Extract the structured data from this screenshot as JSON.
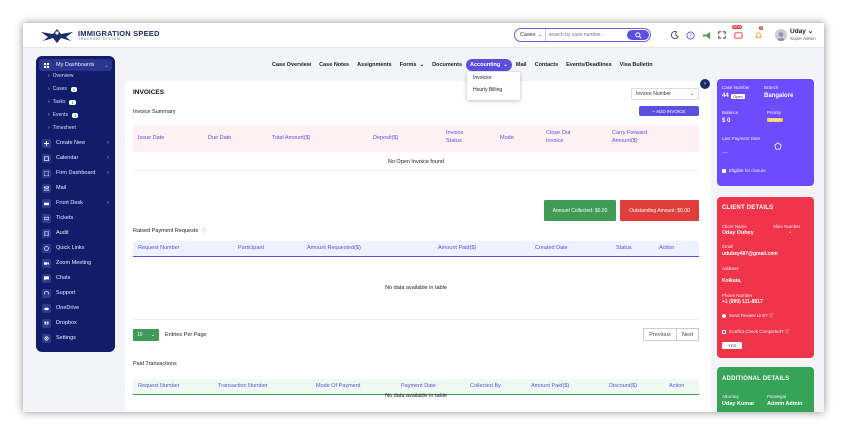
{
  "header": {
    "logo_title": "IMMIGRATION SPEED",
    "logo_sub": "TRACKING SYSTEM",
    "search_scope": "Cases",
    "search_placeholder": "search by case number...",
    "notif_badge_1": "NEW",
    "notif_badge_2": "0",
    "user_name": "Uday",
    "user_role": "Super Admin"
  },
  "sidebar": {
    "items": [
      {
        "label": "My Dashboards"
      },
      {
        "label": "Create New"
      },
      {
        "label": "Calendar"
      },
      {
        "label": "Firm Dashboard"
      },
      {
        "label": "Mail"
      },
      {
        "label": "Front Desk"
      },
      {
        "label": "Tickets"
      },
      {
        "label": "Audit"
      },
      {
        "label": "Quick Links"
      },
      {
        "label": "Zoom Meeting"
      },
      {
        "label": "Chats"
      },
      {
        "label": "Support"
      },
      {
        "label": "OneDrive"
      },
      {
        "label": "Dropbox"
      },
      {
        "label": "Settings"
      }
    ],
    "subitems": [
      {
        "label": "Overview",
        "count": ""
      },
      {
        "label": "Cases",
        "count": "1"
      },
      {
        "label": "Tasks",
        "count": "1"
      },
      {
        "label": "Events",
        "count": "1"
      },
      {
        "label": "Timesheet",
        "count": ""
      }
    ]
  },
  "tabs": [
    {
      "label": "Case Overview"
    },
    {
      "label": "Case Notes"
    },
    {
      "label": "Assignments"
    },
    {
      "label": "Forms"
    },
    {
      "label": "Documents"
    },
    {
      "label": "Accounting"
    },
    {
      "label": "Mail"
    },
    {
      "label": "Contacts"
    },
    {
      "label": "Events/Deadlines"
    },
    {
      "label": "Visa Bulletin"
    }
  ],
  "accounting_menu": {
    "invoices": "Invoices",
    "hourly": "Hourly Billing"
  },
  "invoices": {
    "title": "INVOICES",
    "select_value": "Invoice Number",
    "summary_title": "Invoice Summary",
    "add_button": "+ ADD INVOICE",
    "columns": [
      "Issue Date",
      "Due Date",
      "Total Amount($)",
      "Deposit($)",
      "Invoice Status",
      "Mode",
      "Close Out Invoice",
      "Carry Forward Amount($)"
    ],
    "empty": "No Open Invoice found",
    "collected": "Amount Collected: $0.00",
    "outstanding": "Outstanding Amount: $0.00"
  },
  "payment_requests": {
    "title": "Raised Payment Requests",
    "columns": [
      "Request Number",
      "Participant",
      "Amount Requested($)",
      "Amount Paid($)",
      "Created Date",
      "Status",
      "Action"
    ],
    "empty": "No data available in table",
    "entries_value": "10",
    "entries_label": "Entries Per Page",
    "prev": "Previous",
    "next": "Next"
  },
  "paid_transactions": {
    "title": "Paid Transactions",
    "columns": [
      "Request Number",
      "Transaction Number",
      "Mode Of Payment",
      "Payment Date",
      "Collected By",
      "Amount Paid($)",
      "Discount($)",
      "Action"
    ],
    "empty": "No data available in table"
  },
  "case_card": {
    "case_number_label": "Case Number",
    "case_number": "44",
    "open_badge": "Open",
    "branch_label": "Branch",
    "branch": "Bangalore",
    "balance_label": "Balance",
    "balance": "$ 0",
    "priority_label": "Priority",
    "priority": "Medium",
    "last_payment_label": "Last Payment Date",
    "last_payment": "----",
    "eligible_label": "Eligible for closure"
  },
  "client_card": {
    "title": "CLIENT DETAILS",
    "client_name_label": "Client Name",
    "client_name": "Uday Dubey",
    "alien_label": "Alien Number",
    "email_label": "Email",
    "email": "udubey487@gmail.com",
    "address_label": "Address",
    "address": "Kolkata,",
    "phone_label": "Phone Number",
    "phone": "+1 (999) 111-8917",
    "send_review": "Send Review Link?",
    "conflict": "Conflict Check Completed?",
    "yes": "YES"
  },
  "additional_card": {
    "title": "ADDITIONAL DETAILS",
    "attorney_label": "Attorney",
    "attorney": "Uday Kumar",
    "paralegal_label": "Paralegal",
    "paralegal": "Admin Admin"
  },
  "colors": {
    "brand_navy": "#111d6b",
    "accent_purple": "#5b4fe0",
    "success_green": "#3f9b56",
    "danger_red": "#e23d3d"
  }
}
